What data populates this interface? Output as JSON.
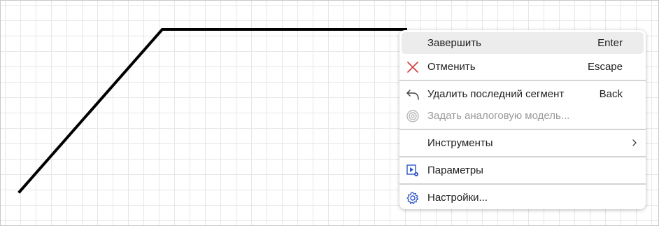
{
  "menu": {
    "finish": {
      "label": "Завершить",
      "shortcut": "Enter"
    },
    "cancel": {
      "label": "Отменить",
      "shortcut": "Escape"
    },
    "delete_last": {
      "label": "Удалить последний сегмент",
      "shortcut": "Back"
    },
    "set_analog": {
      "label": "Задать аналоговую модель..."
    },
    "tools": {
      "label": "Инструменты"
    },
    "parameters": {
      "label": "Параметры"
    },
    "settings": {
      "label": "Настройки..."
    }
  },
  "colors": {
    "accent_red": "#d33a3a",
    "accent_blue": "#2f56c7",
    "disabled_gray": "#9a9a9a"
  },
  "icons": [
    "close-icon",
    "undo-icon",
    "spiral-icon",
    "parameters-icon",
    "gear-icon",
    "chevron-right-icon"
  ]
}
